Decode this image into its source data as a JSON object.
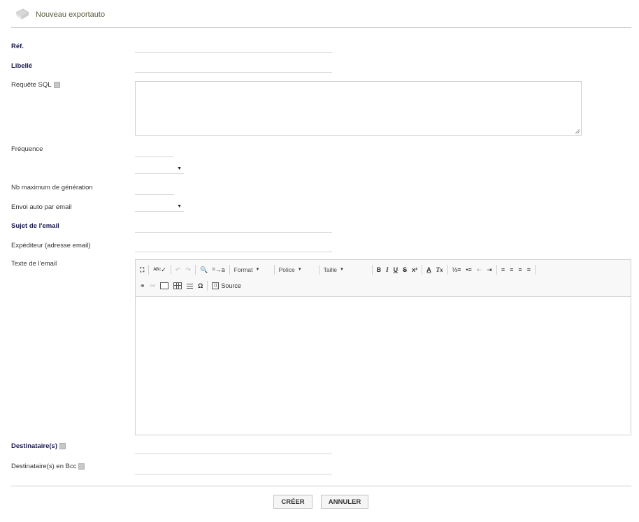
{
  "header": {
    "title": "Nouveau exportauto",
    "icon": "folder-icon"
  },
  "fields": {
    "ref": {
      "label": "Réf.",
      "value": ""
    },
    "libelle": {
      "label": "Libellé",
      "value": ""
    },
    "requete": {
      "label": "Requête SQL",
      "value": ""
    },
    "frequence": {
      "label": "Fréquence",
      "value": "",
      "unit": ""
    },
    "nbmax": {
      "label": "Nb maximum de génération",
      "value": ""
    },
    "envoi": {
      "label": "Envoi auto par email",
      "value": ""
    },
    "sujet": {
      "label": "Sujet de l'email",
      "value": ""
    },
    "expediteur": {
      "label": "Expéditeur (adresse email)",
      "value": ""
    },
    "texte": {
      "label": "Texte de l'email"
    },
    "destinataires": {
      "label": "Destinataire(s)",
      "value": ""
    },
    "bcc": {
      "label": "Destinataire(s) en Bcc",
      "value": ""
    }
  },
  "editor": {
    "combos": {
      "format": "Format",
      "police": "Police",
      "taille": "Taille"
    },
    "glyphs": {
      "maximize": "⛶",
      "spell": "ᴬᴮᶜ✓",
      "undo": "↶",
      "redo": "↷",
      "find": "🔍",
      "replace": "ᵇ→a",
      "bold": "B",
      "italic": "I",
      "underline": "U",
      "strike": "S",
      "superscript": "x²",
      "textcolor": "A",
      "removeformat": "Tx",
      "ol": "⅓≡",
      "ul": "•≡",
      "outdent": "⇤",
      "indent": "⇥",
      "alignleft": "≡",
      "aligncenter": "≡",
      "alignright": "≡",
      "justify": "≡",
      "link": "⚭",
      "unlink": "⚯",
      "special": "Ω"
    },
    "source_label": "Source"
  },
  "buttons": {
    "create": "CRÉER",
    "cancel": "ANNULER"
  }
}
